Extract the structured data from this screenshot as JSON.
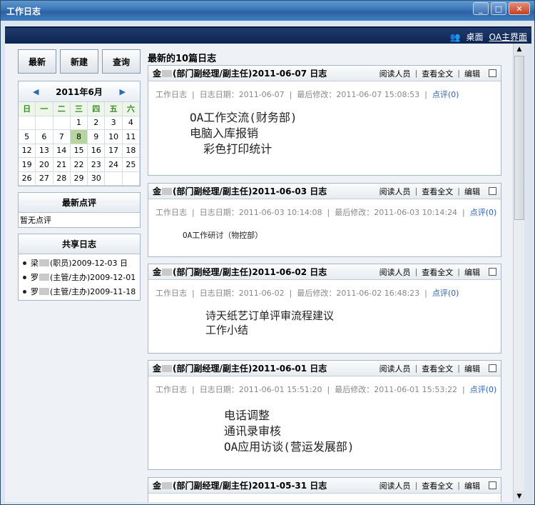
{
  "window": {
    "title": "工作日志",
    "minimize": "_",
    "maximize": "□",
    "close": "✕"
  },
  "topbar": {
    "desktop_label": "桌面",
    "oa_label": "OA主界面"
  },
  "buttons": {
    "latest": "最新",
    "new": "新建",
    "query": "查询"
  },
  "calendar": {
    "month_label": "2011年6月",
    "prev": "◀",
    "next": "▶",
    "weekdays": [
      "日",
      "一",
      "二",
      "三",
      "四",
      "五",
      "六"
    ],
    "days": [
      "",
      "",
      "",
      "1",
      "2",
      "3",
      "4",
      "5",
      "6",
      "7",
      "8",
      "9",
      "10",
      "11",
      "12",
      "13",
      "14",
      "15",
      "16",
      "17",
      "18",
      "19",
      "20",
      "21",
      "22",
      "23",
      "24",
      "25",
      "26",
      "27",
      "28",
      "29",
      "30",
      "",
      ""
    ],
    "today": "8"
  },
  "latest_comments": {
    "title": "最新点评",
    "empty": "暂无点评"
  },
  "shared": {
    "title": "共享日志",
    "items": [
      {
        "name": "梁",
        "role_date": "(职员)2009-12-03 日"
      },
      {
        "name": "罗",
        "role_date": "(主管/主办)2009-12-01"
      },
      {
        "name": "罗",
        "role_date": "(主管/主办)2009-11-18"
      }
    ]
  },
  "main": {
    "title": "最新的10篇日志",
    "read_label": "阅读人员",
    "full_label": "查看全文",
    "edit_label": "编辑",
    "entries": [
      {
        "author": "金",
        "who": "(部门副经理/副主任)2011-06-07 日志",
        "meta_type": "工作日志",
        "date": "日志日期：2011-06-07",
        "modified": "最后修改：2011-06-07 15:08:53",
        "comment": "点评(0)",
        "lines": [
          "OA工作交流(财务部)",
          "电脑入库报销",
          "  彩色打印统计"
        ]
      },
      {
        "author": "金",
        "who": "(部门副经理/副主任)2011-06-03 日志",
        "meta_type": "工作日志",
        "date": "日志日期：2011-06-03 10:14:08",
        "modified": "最后修改：2011-06-03 10:14:24",
        "comment": "点评(0)",
        "lines": [
          "OA工作研讨（物控部）"
        ]
      },
      {
        "author": "金",
        "who": "(部门副经理/副主任)2011-06-02 日志",
        "meta_type": "工作日志",
        "date": "日志日期：2011-06-02",
        "modified": "最后修改：2011-06-02 16:48:23",
        "comment": "点评(0)",
        "lines": [
          "诗天纸艺订单评审流程建议",
          "工作小结"
        ]
      },
      {
        "author": "金",
        "who": "(部门副经理/副主任)2011-06-01 日志",
        "meta_type": "工作日志",
        "date": "日志日期：2011-06-01 15:51:20",
        "modified": "最后修改：2011-06-01 15:53:22",
        "comment": "点评(0)",
        "lines": [
          "电话调整",
          "通讯录审核",
          "OA应用访谈(营运发展部)"
        ]
      },
      {
        "author": "金",
        "who": "(部门副经理/副主任)2011-05-31 日志"
      }
    ]
  }
}
